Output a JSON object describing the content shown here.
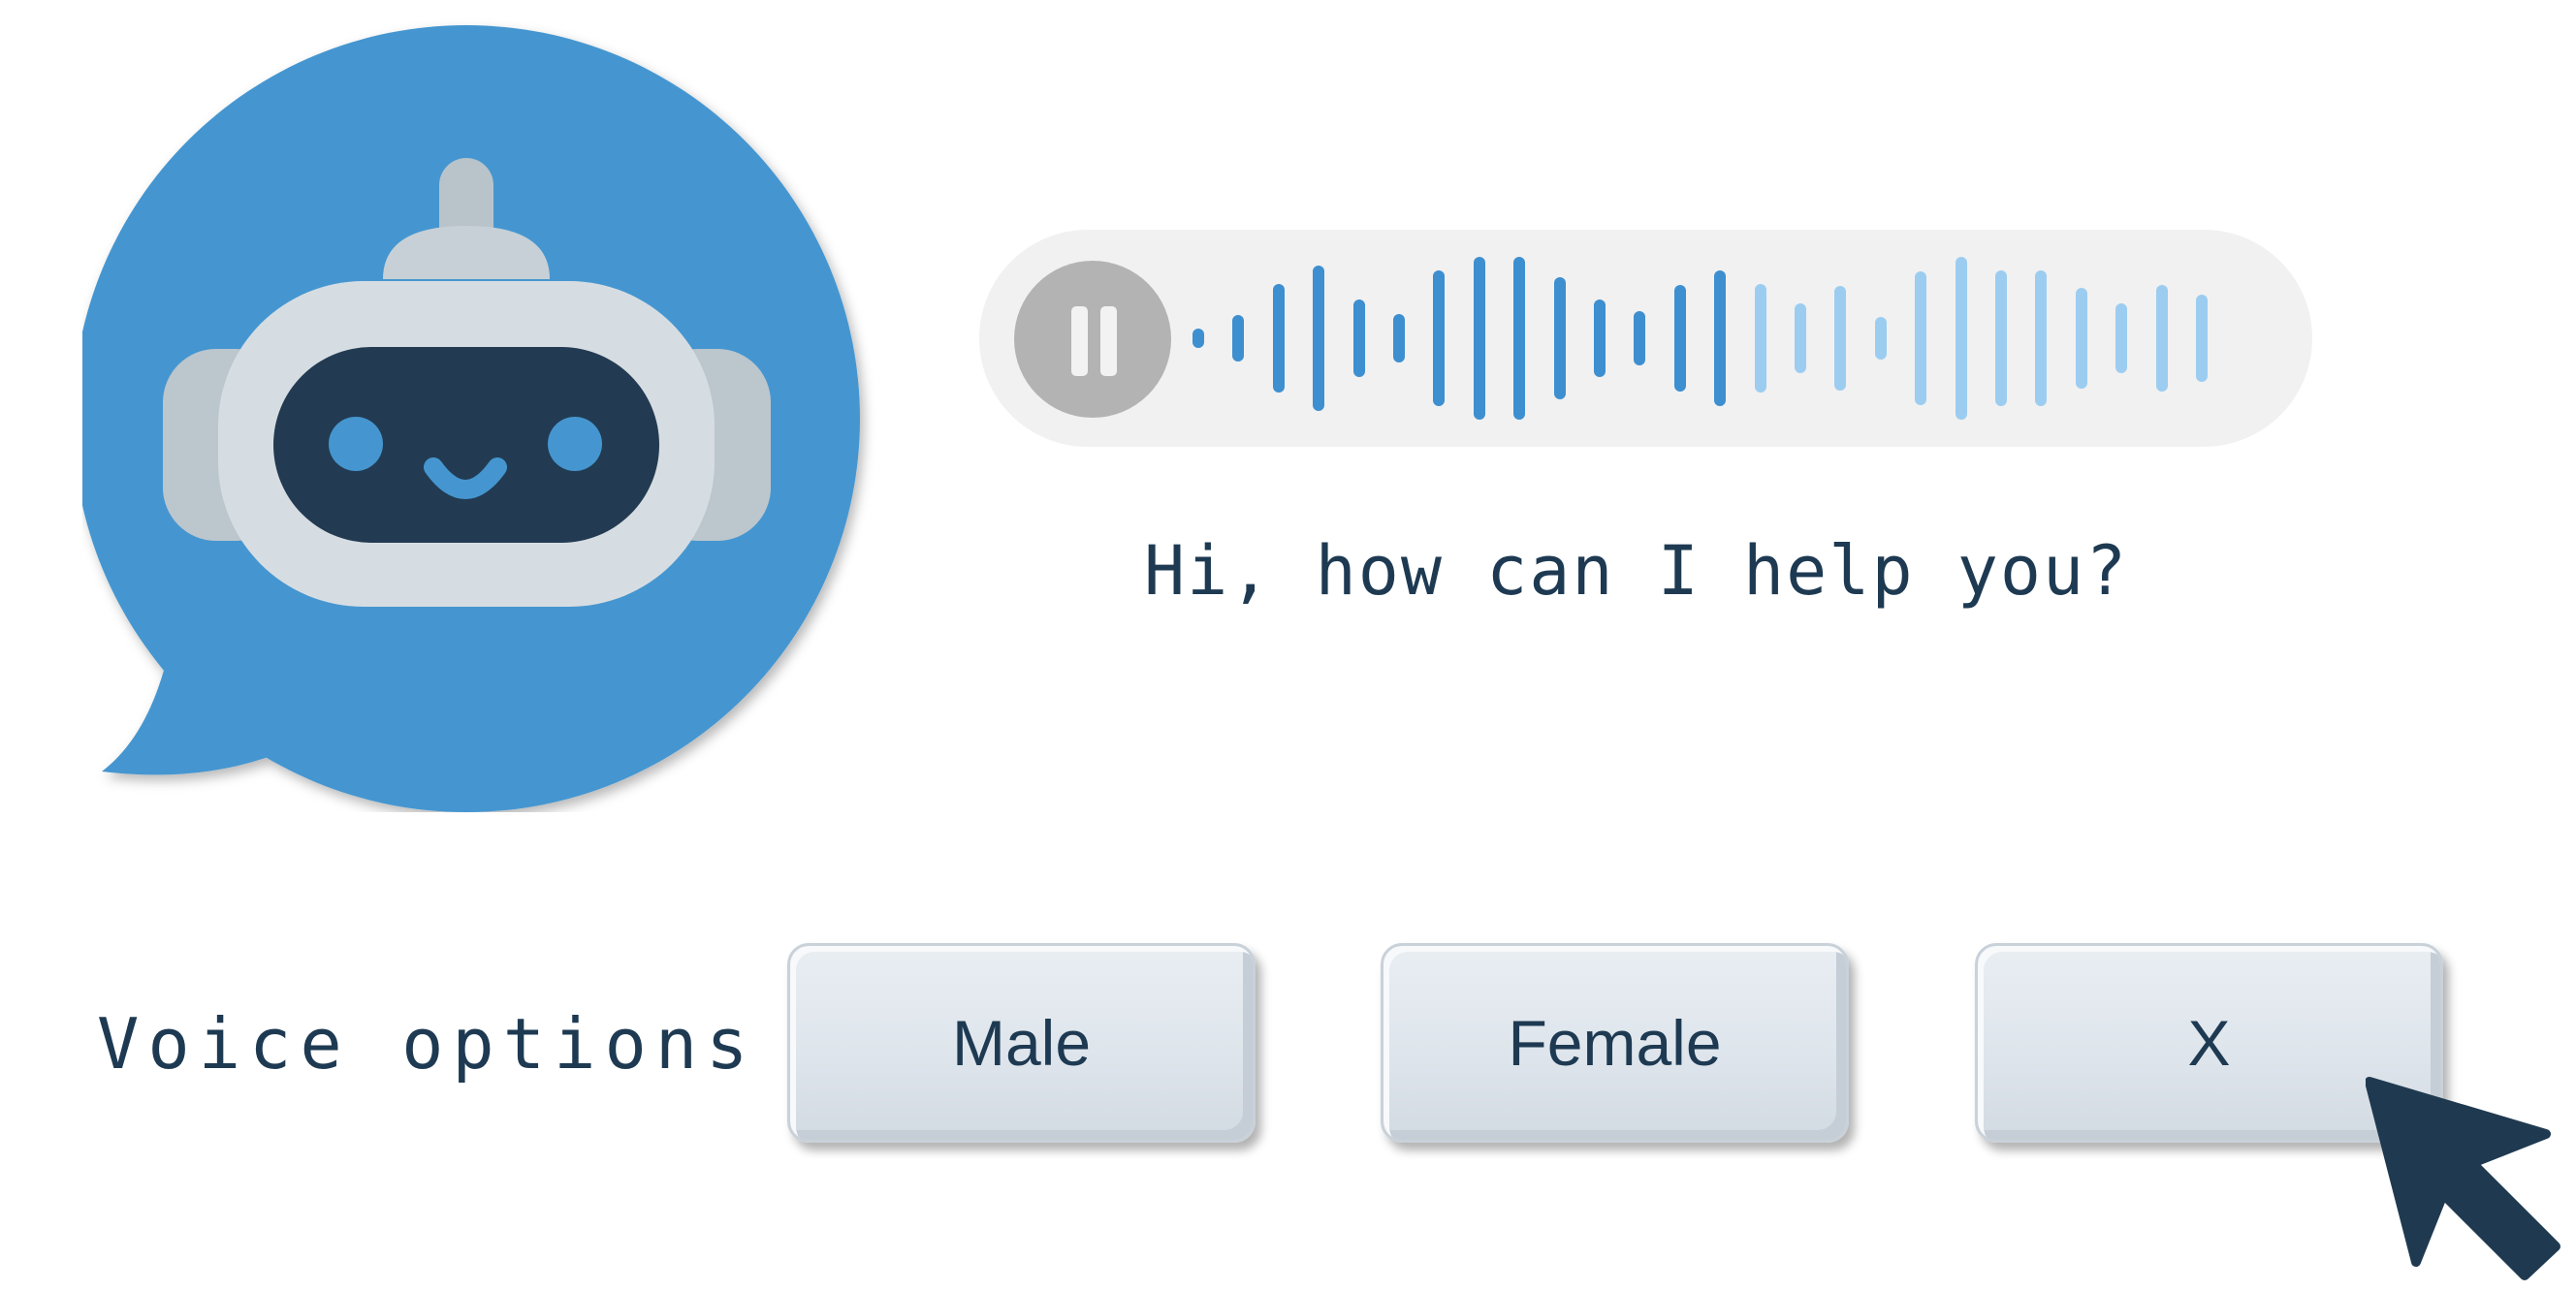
{
  "assistant": {
    "icon": "robot-chat-bubble-icon",
    "accent_color": "#4596d0"
  },
  "voice_message": {
    "state": "playing",
    "pause_icon": "pause-icon",
    "played_fraction": 0.52,
    "played_color": "#3d8fd0",
    "unplayed_color": "#9ccdf0"
  },
  "greeting": {
    "text": "Hi, how can I help you?"
  },
  "voice_options": {
    "label": "Voice options",
    "buttons": [
      {
        "label": "Male"
      },
      {
        "label": "Female"
      },
      {
        "label": "X"
      }
    ]
  },
  "cursor": {
    "icon": "mouse-pointer-icon",
    "color": "#1f3a50"
  }
}
